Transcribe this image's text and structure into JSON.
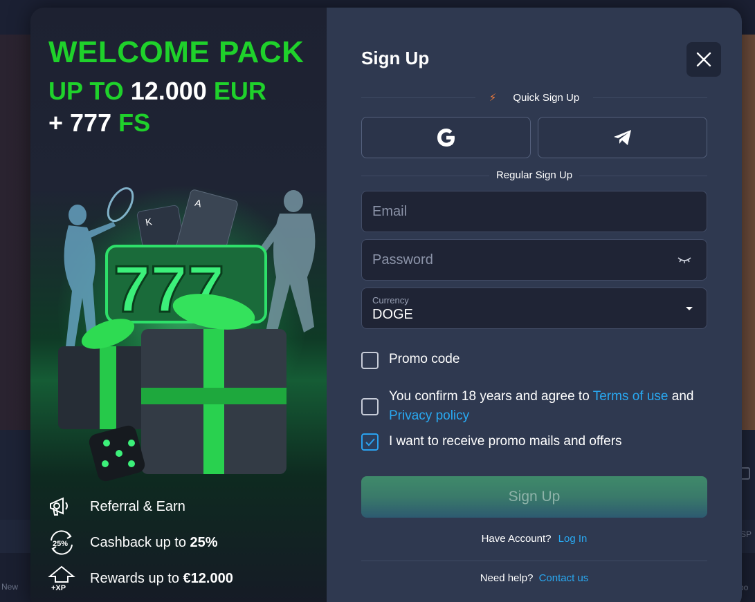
{
  "backdrop": {
    "left_text": "New",
    "right_text": "SP",
    "right_text2": "po"
  },
  "promo": {
    "title": "WELCOME PACK",
    "line2_prefix": "UP TO",
    "line2_amount": "12.000",
    "line2_suffix": "EUR",
    "line3_prefix": "+ 777",
    "line3_suffix": "FS",
    "features": [
      {
        "icon": "megaphone-icon",
        "text": "Referral & Earn",
        "bold": ""
      },
      {
        "icon": "cashback-25-icon",
        "icon_text": "25%",
        "text": "Cashback up to ",
        "bold": "25%"
      },
      {
        "icon": "xp-arrow-icon",
        "icon_text": "+XP",
        "text": "Rewards up to ",
        "bold": "€12.000"
      }
    ],
    "colors": {
      "accent": "#1fd12b"
    }
  },
  "form": {
    "title": "Sign Up",
    "quick_label": "Quick Sign Up",
    "regular_label": "Regular Sign Up",
    "social": [
      {
        "name": "google-icon"
      },
      {
        "name": "telegram-icon"
      }
    ],
    "email_placeholder": "Email",
    "password_placeholder": "Password",
    "currency_label": "Currency",
    "currency_value": "DOGE",
    "promo_code_label": "Promo code",
    "terms_prefix": "You confirm 18 years and agree to ",
    "terms_link": "Terms of use",
    "terms_and": " and",
    "privacy_link": "Privacy policy",
    "promo_mails_label": "I want to receive promo mails and offers",
    "promo_mails_checked": true,
    "signup_label": "Sign Up",
    "have_account": "Have Account?",
    "login_link": "Log In",
    "need_help": "Need help?",
    "contact_link": "Contact us",
    "colors": {
      "link": "#29a9f2",
      "panel": "#2f3950"
    }
  }
}
